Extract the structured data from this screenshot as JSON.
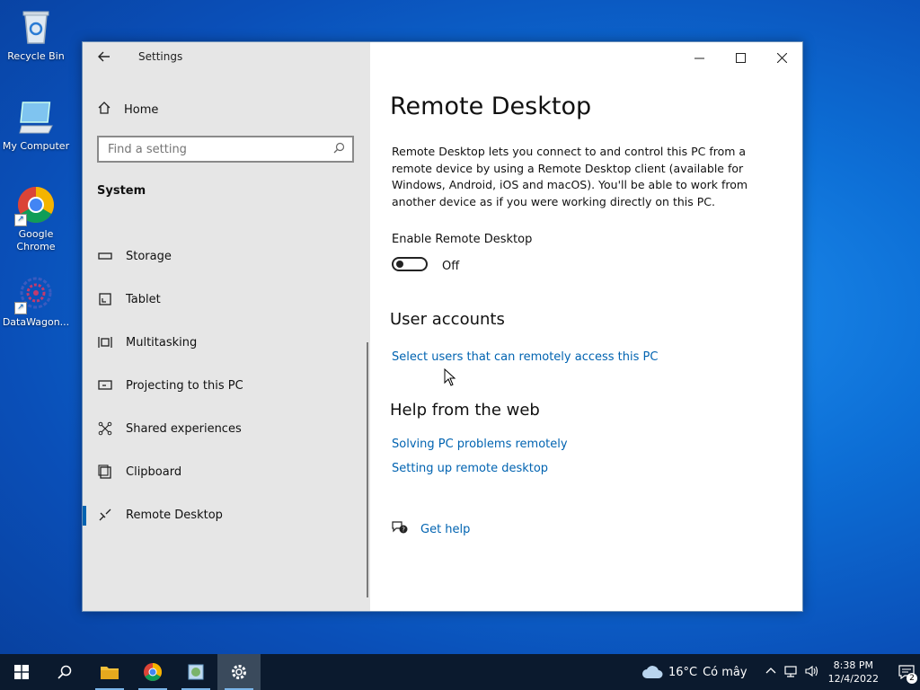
{
  "desktop": {
    "icons": [
      {
        "label": "Recycle Bin"
      },
      {
        "label": "My Computer"
      },
      {
        "label": "Google Chrome"
      },
      {
        "label": "DataWagon..."
      }
    ]
  },
  "window": {
    "app_title": "Settings",
    "controls": {
      "minimize": "—",
      "maximize": "☐",
      "close": "✕"
    }
  },
  "sidebar": {
    "home_label": "Home",
    "search_placeholder": "Find a setting",
    "section": "System",
    "items": [
      {
        "label": "Storage",
        "icon": "storage-icon"
      },
      {
        "label": "Tablet",
        "icon": "tablet-icon"
      },
      {
        "label": "Multitasking",
        "icon": "multitasking-icon"
      },
      {
        "label": "Projecting to this PC",
        "icon": "projecting-icon"
      },
      {
        "label": "Shared experiences",
        "icon": "shared-experiences-icon"
      },
      {
        "label": "Clipboard",
        "icon": "clipboard-icon"
      },
      {
        "label": "Remote Desktop",
        "icon": "remote-desktop-icon",
        "active": true
      }
    ]
  },
  "content": {
    "title": "Remote Desktop",
    "description": "Remote Desktop lets you connect to and control this PC from a remote device by using a Remote Desktop client (available for Windows, Android, iOS and macOS). You'll be able to work from another device as if you were working directly on this PC.",
    "toggle_label": "Enable Remote Desktop",
    "toggle_state": "Off",
    "user_accounts_heading": "User accounts",
    "user_accounts_link": "Select users that can remotely access this PC",
    "help_heading": "Help from the web",
    "help_links": [
      "Solving PC problems remotely",
      "Setting up remote desktop"
    ],
    "get_help": "Get help"
  },
  "taskbar": {
    "weather_temp": "16°C",
    "weather_text": "Có mây",
    "time": "8:38 PM",
    "date": "12/4/2022",
    "notification_count": "2"
  }
}
